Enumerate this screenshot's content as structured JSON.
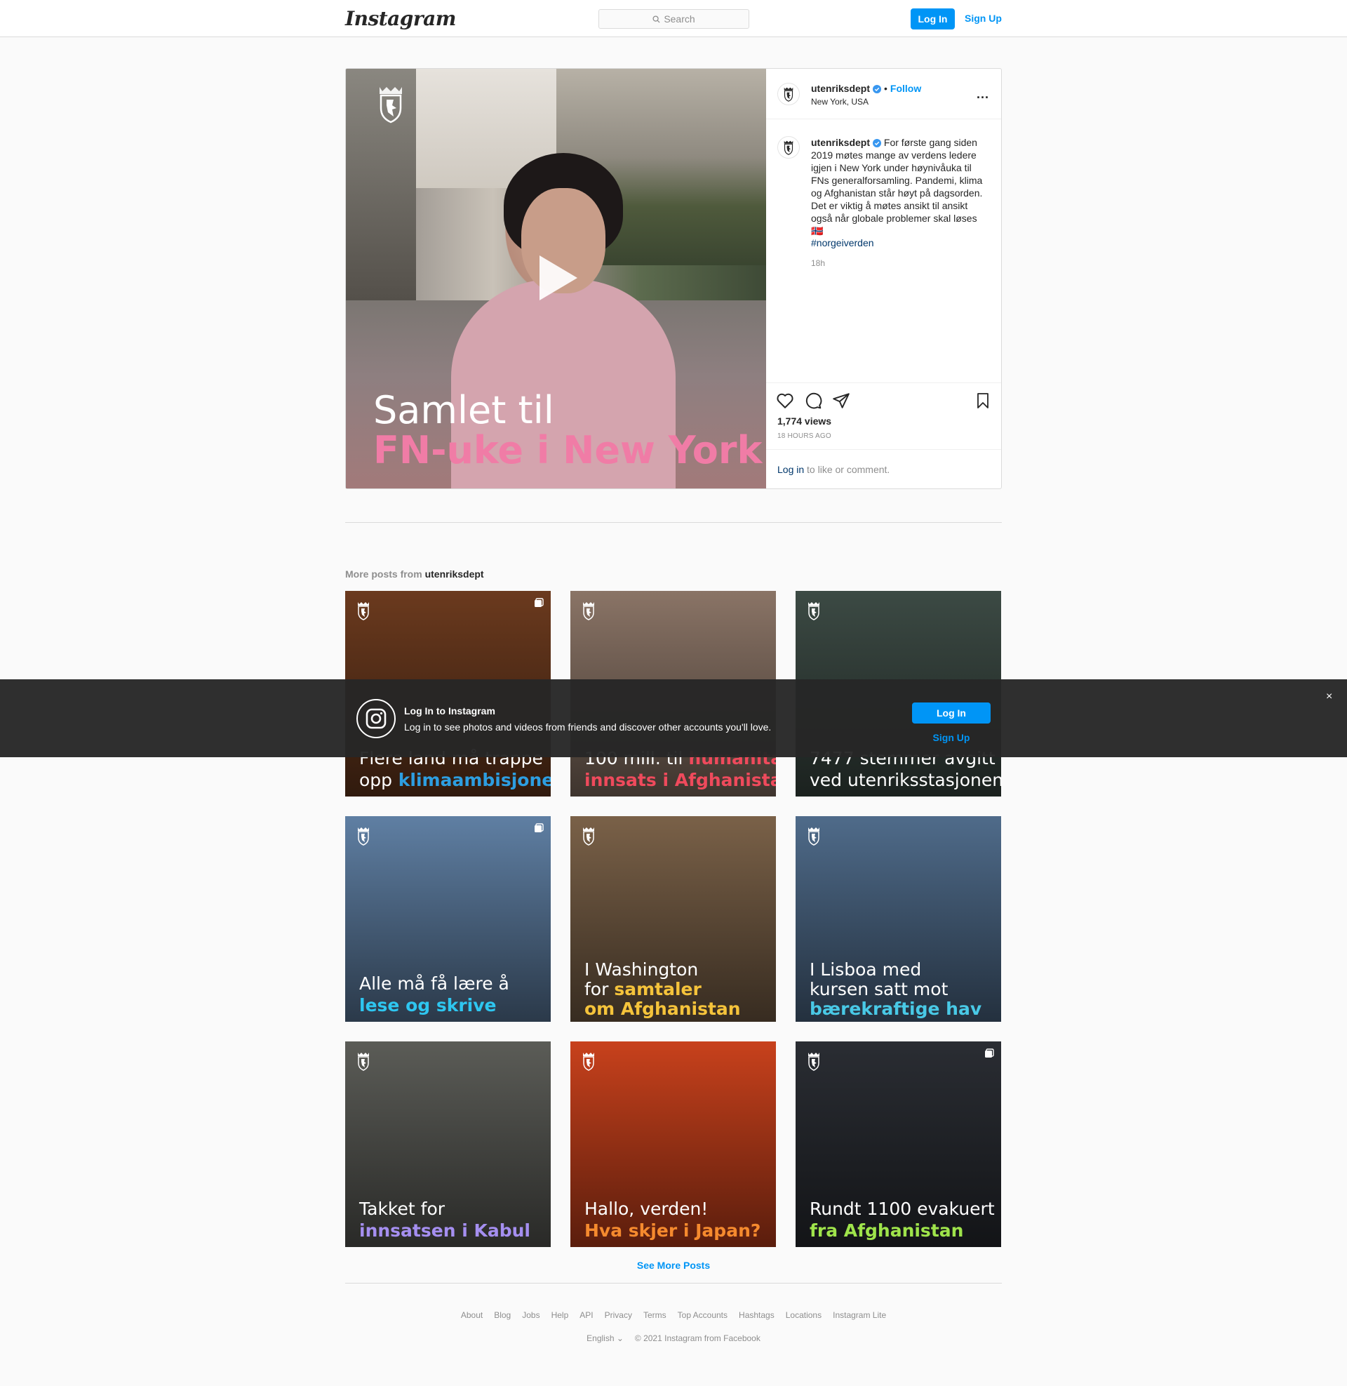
{
  "header": {
    "logo": "Instagram",
    "search_placeholder": "Search",
    "login_label": "Log In",
    "signup_label": "Sign Up"
  },
  "post": {
    "username": "utenriksdept",
    "follow_label": "Follow",
    "location": "New York, USA",
    "more_label": "...",
    "caption": "For første gang siden 2019 møtes mange av verdens ledere igjen i New York under høynivåuka til FNs generalforsamling. Pandemi, klima og Afghanistan står høyt på dagsorden. Det er viktig å møtes ansikt til ansikt også når globale problemer skal løses 🇳🇴",
    "hashtag": "#norgeiverden",
    "time_short": "18h",
    "video_caption_line1": "Samlet til",
    "video_caption_line2": "FN-uke i New York",
    "views": "1,774 views",
    "time_long": "18 HOURS AGO",
    "login_link": "Log in",
    "login_suffix": " to like or comment."
  },
  "more_posts": {
    "prefix": "More posts from ",
    "username": "utenriksdept",
    "tiles": [
      {
        "line1": "Flere land må trappe",
        "line2": "opp",
        "line2b": "klimaambisjonene",
        "color": "#2d9ee0",
        "bg": "#6b3a1e"
      },
      {
        "line1": "100 mill. til",
        "line1b": "humanitær",
        "line2": "innsats i Afghanistan",
        "color": "#ef4a5c",
        "bg": "#8a7466"
      },
      {
        "line1": "7477 stemmer avgitt",
        "line2": "ved utenriksstasjonene",
        "color": "#f08a4b",
        "bg": "#3c4a44"
      },
      {
        "line1": "Alle må få lære å",
        "line2": "lese og skrive",
        "color": "#2ec6f0",
        "bg": "#5f7fa3"
      },
      {
        "line1": "I Washington",
        "line1c": "for",
        "line1d": "samtaler",
        "line2": "om Afghanistan",
        "color": "#f5c33b",
        "bg": "#7a6148"
      },
      {
        "line1": "I Lisboa med",
        "line1c": "kursen satt mot",
        "line2": "bærekraftige hav",
        "color": "#49c9e6",
        "bg": "#4f6b8a"
      },
      {
        "line1": "Takket for",
        "line2": "innsatsen i Kabul",
        "color": "#a58ff0",
        "bg": "#5b5c57"
      },
      {
        "line1": "Hallo, verden!",
        "line2": "Hva skjer i Japan?",
        "color": "#f58a2e",
        "bg": "#c8411c"
      },
      {
        "line1": "Rundt 1100 evakuert",
        "line2": "fra Afghanistan",
        "color": "#9fe44b",
        "bg": "#2a2d33"
      }
    ],
    "see_more": "See More Posts"
  },
  "footer": {
    "links": [
      "About",
      "Blog",
      "Jobs",
      "Help",
      "API",
      "Privacy",
      "Terms",
      "Top Accounts",
      "Hashtags",
      "Locations",
      "Instagram Lite"
    ],
    "language": "English",
    "copyright": "© 2021 Instagram from Facebook"
  },
  "login_overlay": {
    "title": "Log In to Instagram",
    "subtitle": "Log in to see photos and videos from friends and discover other accounts you'll love.",
    "login_label": "Log In",
    "signup_label": "Sign Up",
    "close_label": "×"
  },
  "colors": {
    "accent": "#0095f6",
    "link_dark": "#00376b",
    "pink_caption": "#f07ca6"
  }
}
